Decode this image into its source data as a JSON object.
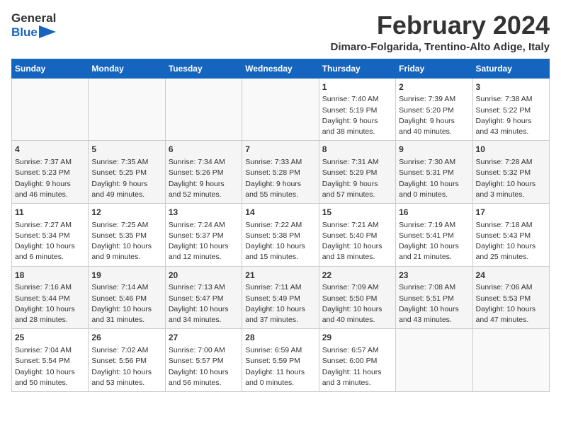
{
  "logo": {
    "text_general": "General",
    "text_blue": "Blue",
    "icon": "▶"
  },
  "title": "February 2024",
  "subtitle": "Dimaro-Folgarida, Trentino-Alto Adige, Italy",
  "days_of_week": [
    "Sunday",
    "Monday",
    "Tuesday",
    "Wednesday",
    "Thursday",
    "Friday",
    "Saturday"
  ],
  "weeks": [
    {
      "alt": false,
      "days": [
        {
          "num": "",
          "info": ""
        },
        {
          "num": "",
          "info": ""
        },
        {
          "num": "",
          "info": ""
        },
        {
          "num": "",
          "info": ""
        },
        {
          "num": "1",
          "info": "Sunrise: 7:40 AM\nSunset: 5:19 PM\nDaylight: 9 hours\nand 38 minutes."
        },
        {
          "num": "2",
          "info": "Sunrise: 7:39 AM\nSunset: 5:20 PM\nDaylight: 9 hours\nand 40 minutes."
        },
        {
          "num": "3",
          "info": "Sunrise: 7:38 AM\nSunset: 5:22 PM\nDaylight: 9 hours\nand 43 minutes."
        }
      ]
    },
    {
      "alt": true,
      "days": [
        {
          "num": "4",
          "info": "Sunrise: 7:37 AM\nSunset: 5:23 PM\nDaylight: 9 hours\nand 46 minutes."
        },
        {
          "num": "5",
          "info": "Sunrise: 7:35 AM\nSunset: 5:25 PM\nDaylight: 9 hours\nand 49 minutes."
        },
        {
          "num": "6",
          "info": "Sunrise: 7:34 AM\nSunset: 5:26 PM\nDaylight: 9 hours\nand 52 minutes."
        },
        {
          "num": "7",
          "info": "Sunrise: 7:33 AM\nSunset: 5:28 PM\nDaylight: 9 hours\nand 55 minutes."
        },
        {
          "num": "8",
          "info": "Sunrise: 7:31 AM\nSunset: 5:29 PM\nDaylight: 9 hours\nand 57 minutes."
        },
        {
          "num": "9",
          "info": "Sunrise: 7:30 AM\nSunset: 5:31 PM\nDaylight: 10 hours\nand 0 minutes."
        },
        {
          "num": "10",
          "info": "Sunrise: 7:28 AM\nSunset: 5:32 PM\nDaylight: 10 hours\nand 3 minutes."
        }
      ]
    },
    {
      "alt": false,
      "days": [
        {
          "num": "11",
          "info": "Sunrise: 7:27 AM\nSunset: 5:34 PM\nDaylight: 10 hours\nand 6 minutes."
        },
        {
          "num": "12",
          "info": "Sunrise: 7:25 AM\nSunset: 5:35 PM\nDaylight: 10 hours\nand 9 minutes."
        },
        {
          "num": "13",
          "info": "Sunrise: 7:24 AM\nSunset: 5:37 PM\nDaylight: 10 hours\nand 12 minutes."
        },
        {
          "num": "14",
          "info": "Sunrise: 7:22 AM\nSunset: 5:38 PM\nDaylight: 10 hours\nand 15 minutes."
        },
        {
          "num": "15",
          "info": "Sunrise: 7:21 AM\nSunset: 5:40 PM\nDaylight: 10 hours\nand 18 minutes."
        },
        {
          "num": "16",
          "info": "Sunrise: 7:19 AM\nSunset: 5:41 PM\nDaylight: 10 hours\nand 21 minutes."
        },
        {
          "num": "17",
          "info": "Sunrise: 7:18 AM\nSunset: 5:43 PM\nDaylight: 10 hours\nand 25 minutes."
        }
      ]
    },
    {
      "alt": true,
      "days": [
        {
          "num": "18",
          "info": "Sunrise: 7:16 AM\nSunset: 5:44 PM\nDaylight: 10 hours\nand 28 minutes."
        },
        {
          "num": "19",
          "info": "Sunrise: 7:14 AM\nSunset: 5:46 PM\nDaylight: 10 hours\nand 31 minutes."
        },
        {
          "num": "20",
          "info": "Sunrise: 7:13 AM\nSunset: 5:47 PM\nDaylight: 10 hours\nand 34 minutes."
        },
        {
          "num": "21",
          "info": "Sunrise: 7:11 AM\nSunset: 5:49 PM\nDaylight: 10 hours\nand 37 minutes."
        },
        {
          "num": "22",
          "info": "Sunrise: 7:09 AM\nSunset: 5:50 PM\nDaylight: 10 hours\nand 40 minutes."
        },
        {
          "num": "23",
          "info": "Sunrise: 7:08 AM\nSunset: 5:51 PM\nDaylight: 10 hours\nand 43 minutes."
        },
        {
          "num": "24",
          "info": "Sunrise: 7:06 AM\nSunset: 5:53 PM\nDaylight: 10 hours\nand 47 minutes."
        }
      ]
    },
    {
      "alt": false,
      "days": [
        {
          "num": "25",
          "info": "Sunrise: 7:04 AM\nSunset: 5:54 PM\nDaylight: 10 hours\nand 50 minutes."
        },
        {
          "num": "26",
          "info": "Sunrise: 7:02 AM\nSunset: 5:56 PM\nDaylight: 10 hours\nand 53 minutes."
        },
        {
          "num": "27",
          "info": "Sunrise: 7:00 AM\nSunset: 5:57 PM\nDaylight: 10 hours\nand 56 minutes."
        },
        {
          "num": "28",
          "info": "Sunrise: 6:59 AM\nSunset: 5:59 PM\nDaylight: 11 hours\nand 0 minutes."
        },
        {
          "num": "29",
          "info": "Sunrise: 6:57 AM\nSunset: 6:00 PM\nDaylight: 11 hours\nand 3 minutes."
        },
        {
          "num": "",
          "info": ""
        },
        {
          "num": "",
          "info": ""
        }
      ]
    }
  ]
}
